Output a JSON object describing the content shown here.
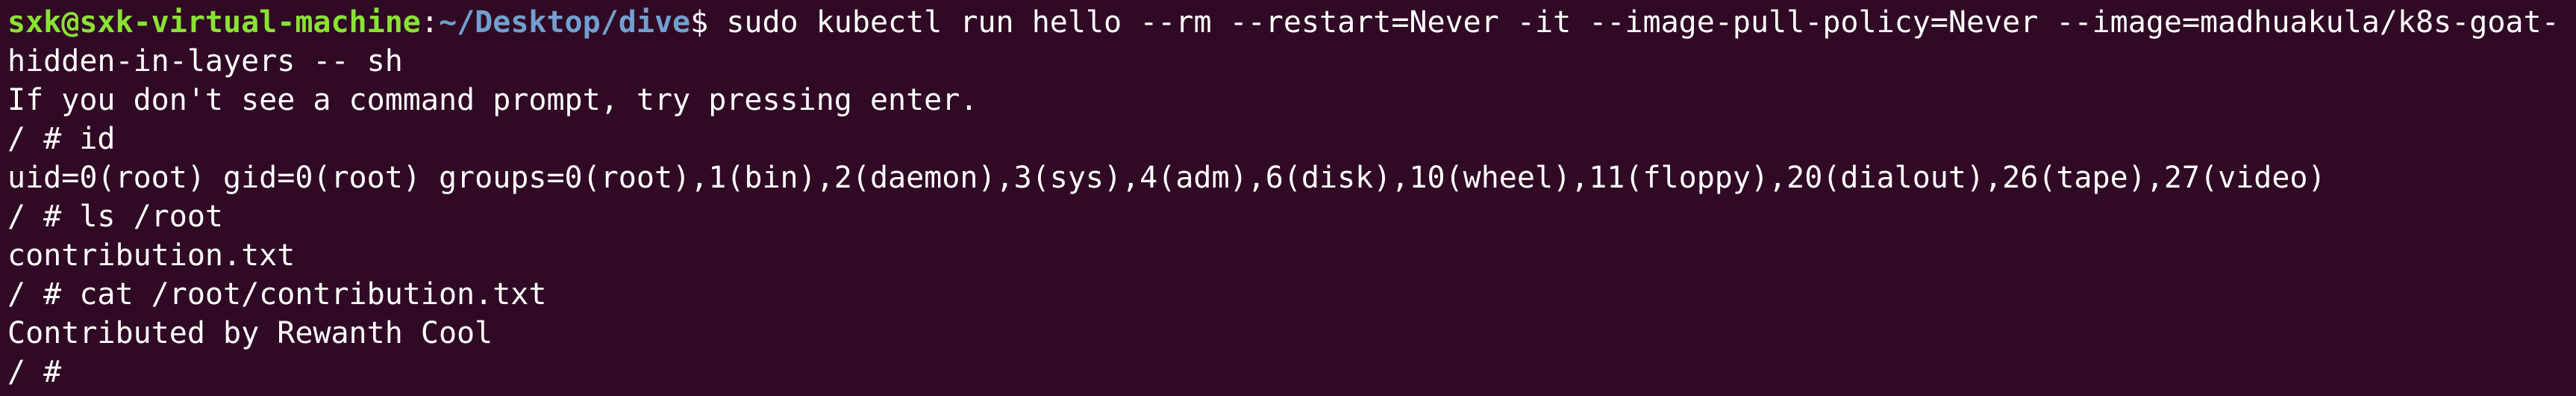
{
  "terminal": {
    "prompt": {
      "user_host": "sxk@sxk-virtual-machine",
      "colon": ":",
      "path": "~/Desktop/dive",
      "dollar": "$ ",
      "command_part1": "sudo kubectl run hello --rm --restart=Never -it --image-pull-policy=Never --image=madhuakula/k8s-goat-",
      "command_part2": "hidden-in-layers -- sh"
    },
    "lines": [
      "If you don't see a command prompt, try pressing enter.",
      "/ # id",
      "uid=0(root) gid=0(root) groups=0(root),1(bin),2(daemon),3(sys),4(adm),6(disk),10(wheel),11(floppy),20(dialout),26(tape),27(video)",
      "/ # ls /root",
      "contribution.txt",
      "/ # cat /root/contribution.txt",
      "Contributed by Rewanth Cool",
      "/ # "
    ],
    "colors": {
      "background": "#300a24",
      "text": "#ffffff",
      "user_host": "#8ae234",
      "path": "#729fcf"
    }
  }
}
